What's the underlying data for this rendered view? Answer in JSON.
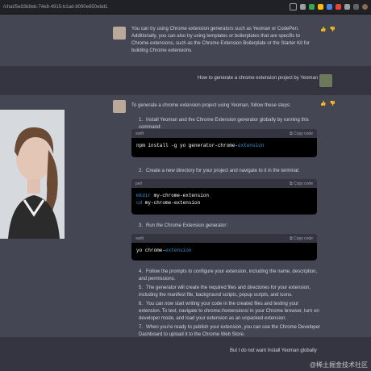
{
  "browser": {
    "url": "/chat/5e83b8eb-74e8-4915-b1ad-8090e650ebd1"
  },
  "messages": {
    "ai1": {
      "text": "You can try using Chrome extension generators such as Yeoman or CodePen. Additionally, you can also try using templates or boilerplates that are specific to Chrome extensions, such as the Chrome Extension Boilerplate or the Starter Kit for building Chrome extensions."
    },
    "user1": {
      "text": "How to generate a chrome extension project by Yeoman"
    },
    "ai2": {
      "intro": "To generate a chrome extension project using Yeoman, follow these steps:",
      "steps": [
        "Install Yeoman and the Chrome Extension generator globally by running this command:",
        "Create a new directory for your project and navigate to it in the terminal:",
        "Run the Chrome Extension generator:",
        "Follow the prompts to configure your extension, including the name, description, and permissions.",
        "The generator will create the required files and directories for your extension, including the manifest file, background scripts, popup scripts, and icons.",
        "You can now start writing your code in the created files and testing your extension. To test, navigate to chrome://extensions/ in your Chrome browser, turn on developer mode, and load your extension as an unpacked extension.",
        "When you're ready to publish your extension, you can use the Chrome Developer Dashboard to upload it to the Chrome Web Store."
      ],
      "code1": {
        "lang": "swift",
        "copy": "Copy code",
        "line1_a": "npm install -g yo generator-chrome-",
        "line1_b": "extension"
      },
      "code2": {
        "lang": "perl",
        "copy": "Copy code",
        "l1a": "mkdir ",
        "l1b": "my-chrome-extension",
        "l2a": "cd ",
        "l2b": "my-chrome-extension"
      },
      "code3": {
        "lang": "swift",
        "copy": "Copy code",
        "la": "yo chrome-",
        "lb": "extension"
      }
    },
    "user2": {
      "text": "But I do not want Install Yeoman globally"
    }
  },
  "watermark": "@稀土掘金技术社区"
}
